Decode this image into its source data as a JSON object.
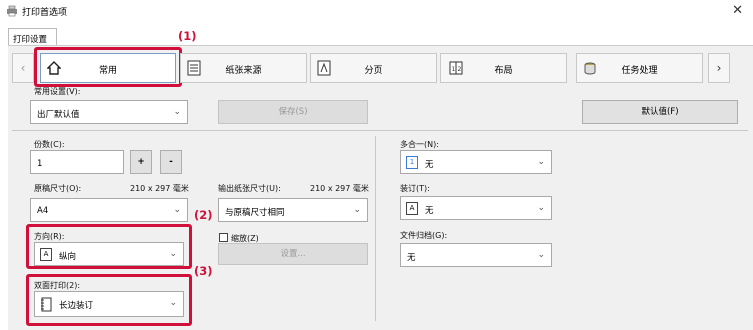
{
  "window": {
    "title": "打印首选项",
    "close_glyph": "✕"
  },
  "tabs": [
    {
      "label": "打印设置"
    }
  ],
  "callouts": {
    "one": "(1)",
    "two": "(2)",
    "three": "(3)"
  },
  "nav": {
    "prev_glyph": "‹",
    "next_glyph": "›"
  },
  "features": [
    {
      "label": "常用",
      "icon": "home-icon"
    },
    {
      "label": "纸张来源",
      "icon": "paper-source-icon"
    },
    {
      "label": "分页",
      "icon": "collate-icon"
    },
    {
      "label": "布局",
      "icon": "layout-icon"
    },
    {
      "label": "任务处理",
      "icon": "job-handling-icon"
    }
  ],
  "favorites": {
    "label": "常用设置(V):",
    "value": "出厂默认值",
    "save_button": "保存(S)",
    "defaults_button": "默认值(F)"
  },
  "copies": {
    "label": "份数(C):",
    "value": "1",
    "plus": "+",
    "minus": "-"
  },
  "original_size": {
    "label": "原稿尺寸(O):",
    "dims": "210 x 297 毫米",
    "value": "A4"
  },
  "output_size": {
    "label": "输出纸张尺寸(U):",
    "dims": "210 x 297 毫米",
    "value": "与原稿尺寸相同"
  },
  "orientation": {
    "label": "方向(R):",
    "value": "纵向",
    "icon_glyph": "A"
  },
  "zoom": {
    "label": "缩放(Z)",
    "checked": false,
    "settings_button": "设置..."
  },
  "duplex": {
    "label": "双面打印(2):",
    "value": "长边装订"
  },
  "nup": {
    "label": "多合一(N):",
    "value": "无",
    "icon_glyph": "1"
  },
  "staple": {
    "label": "装订(T):",
    "value": "无",
    "icon_glyph": "A"
  },
  "filing": {
    "label": "文件归档(G):",
    "value": "无"
  },
  "colors": {
    "callout": "#d0103a"
  }
}
